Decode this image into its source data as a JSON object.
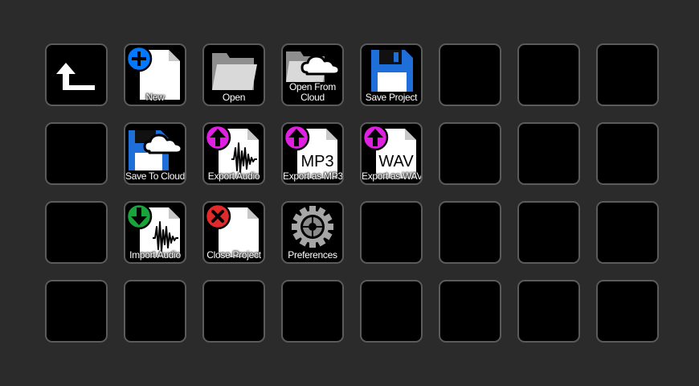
{
  "keys": {
    "back": {
      "label": ""
    },
    "new": {
      "label": "New"
    },
    "open": {
      "label": "Open"
    },
    "open_cloud": {
      "label": "Open From\nCloud"
    },
    "save_project": {
      "label": "Save Project"
    },
    "save_cloud": {
      "label": "Save To Cloud"
    },
    "export_audio": {
      "label": "Export Audio"
    },
    "export_mp3": {
      "label": "Export as MP3",
      "badge": "MP3"
    },
    "export_wav": {
      "label": "Export as WAV",
      "badge": "WAV"
    },
    "import_audio": {
      "label": "Import Audio"
    },
    "close_project": {
      "label": "Close Project"
    },
    "preferences": {
      "label": "Preferences"
    }
  },
  "colors": {
    "background": "#2b2b2b",
    "key_border": "#5b5b5b",
    "add_blue": "#0078ff",
    "save_blue": "#1e6fd9",
    "export_magenta": "#e020e0",
    "import_green": "#1aa33a",
    "close_red": "#e22a2a"
  },
  "icons": {
    "back": "corner-up-left-arrow-icon",
    "new": "new-file-icon",
    "open": "folder-icon",
    "open_cloud": "folder-cloud-icon",
    "save_project": "floppy-disk-icon",
    "save_cloud": "floppy-cloud-icon",
    "export_audio": "export-waveform-icon",
    "export_mp3": "export-mp3-icon",
    "export_wav": "export-wav-icon",
    "import_audio": "import-waveform-icon",
    "close_project": "close-file-icon",
    "preferences": "gear-icon"
  }
}
